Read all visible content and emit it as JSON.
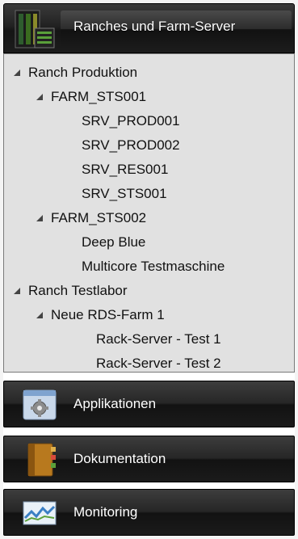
{
  "header": {
    "title": "Ranches und Farm-Server",
    "icon": "server-rack-icon"
  },
  "tree": {
    "ranches": [
      {
        "label": "Ranch Produktion",
        "farms": [
          {
            "label": "FARM_STS001",
            "servers": [
              "SRV_PROD001",
              "SRV_PROD002",
              "SRV_RES001",
              "SRV_STS001"
            ]
          },
          {
            "label": "FARM_STS002",
            "servers": [
              "Deep Blue",
              "Multicore Testmaschine"
            ]
          }
        ]
      },
      {
        "label": "Ranch Testlabor",
        "farms": [
          {
            "label": "Neue RDS-Farm 1",
            "servers": [
              "Rack-Server - Test 1",
              "Rack-Server - Test 2"
            ]
          }
        ]
      }
    ]
  },
  "nav": {
    "applications": {
      "label": "Applikationen",
      "icon": "gear-icon"
    },
    "documentation": {
      "label": "Dokumentation",
      "icon": "book-icon"
    },
    "monitoring": {
      "label": "Monitoring",
      "icon": "chart-icon"
    }
  },
  "colors": {
    "header_bg": "#1c1c1c",
    "tree_bg": "#e1e1e1",
    "text": "#111111"
  }
}
